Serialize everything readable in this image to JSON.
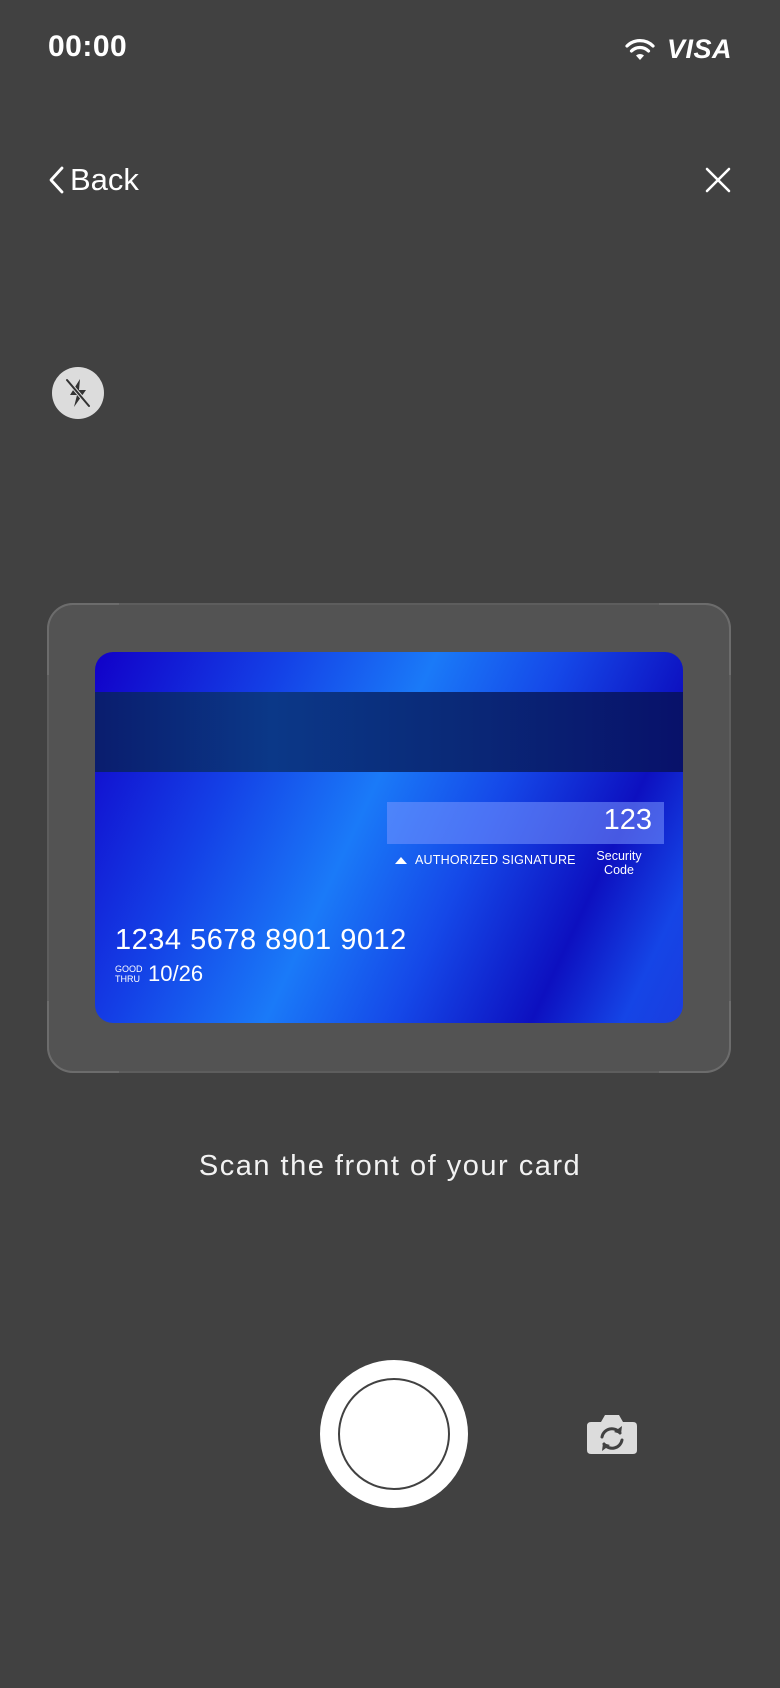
{
  "status_bar": {
    "time": "00:00",
    "carrier": "VISA",
    "wifi_icon": "wifi-icon"
  },
  "nav": {
    "back_label": "Back",
    "close_icon": "close-icon"
  },
  "flash": {
    "icon": "flash-off-icon"
  },
  "card": {
    "security_code": "123",
    "signature_label": "AUTHORIZED SIGNATURE",
    "security_code_label_line1": "Security",
    "security_code_label_line2": "Code",
    "number": "1234 5678 8901 9012",
    "good_thru_line1": "GOOD",
    "good_thru_line2": "THRU",
    "expiry": "10/26"
  },
  "instruction": "Scan the front of your card",
  "controls": {
    "shutter_icon": "shutter-button",
    "switch_camera_icon": "switch-camera-icon"
  }
}
